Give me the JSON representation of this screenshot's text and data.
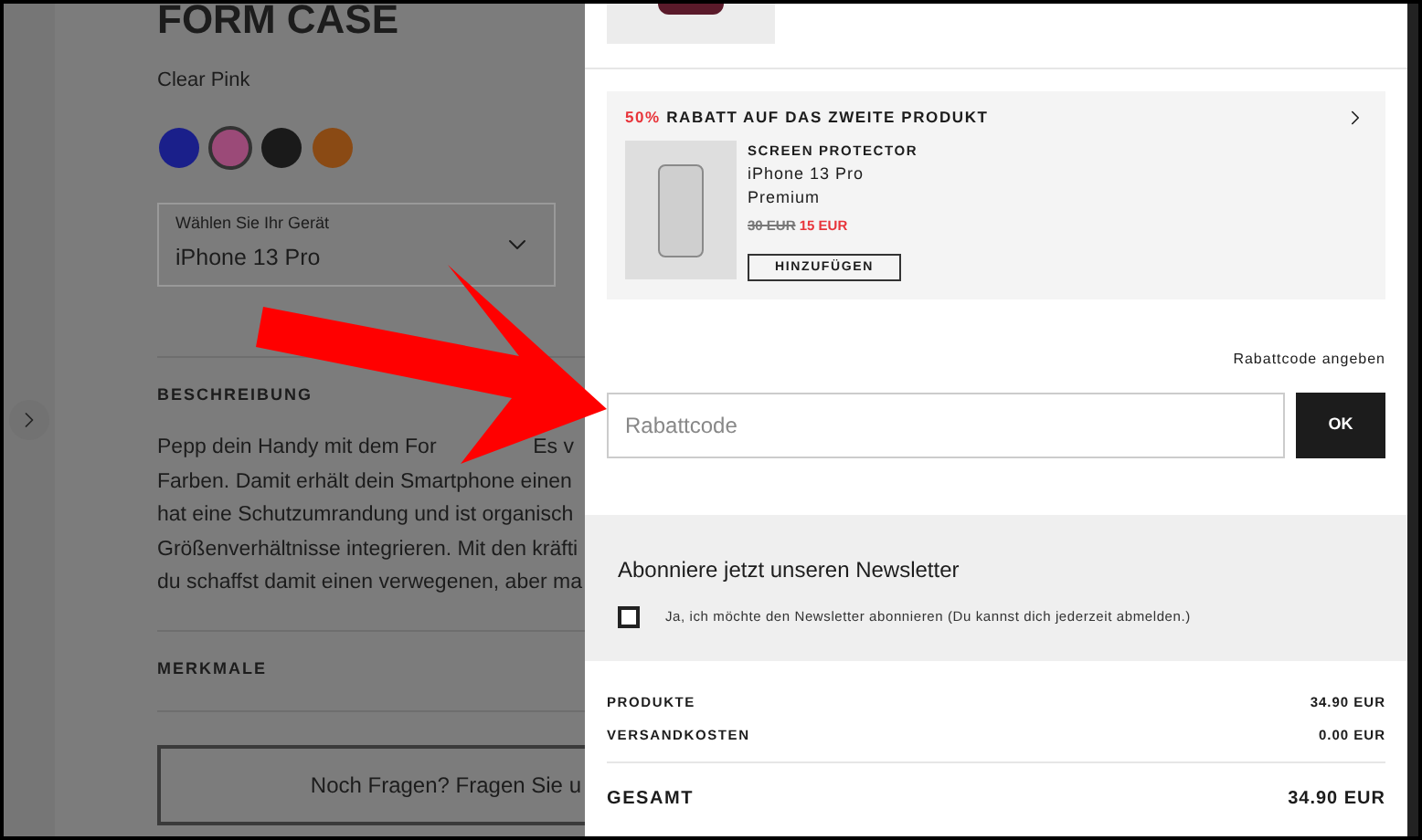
{
  "product_page": {
    "title": "FORM CASE",
    "color_name": "Clear Pink",
    "swatches": [
      {
        "color": "#1a1f8a",
        "selected": false
      },
      {
        "color": "#9b4a78",
        "selected": true
      },
      {
        "color": "#1a1a1a",
        "selected": false
      },
      {
        "color": "#8a4a14",
        "selected": false
      }
    ],
    "device_select": {
      "label": "Wählen Sie Ihr Gerät",
      "value": "iPhone 13 Pro"
    },
    "description": {
      "heading": "BESCHREIBUNG",
      "first_line": {
        "start": "Pepp dein Handy mit dem For",
        "end": "Es v"
      },
      "lines": [
        "Farben. Damit erhält dein Smartphone einen",
        "hat eine Schutzumrandung und ist organisch",
        "Größenverhältnisse integrieren. Mit den kräfti",
        "du schaffst damit einen verwegenen, aber ma"
      ]
    },
    "features": {
      "heading": "MERKMALE"
    },
    "question_button": "Noch Fragen? Fragen Sie u"
  },
  "cart": {
    "promo": {
      "discount": "50%",
      "title": "RABATT AUF DAS ZWEITE PRODUKT",
      "category": "SCREEN PROTECTOR",
      "name_lines": [
        "iPhone 13 Pro",
        "Premium"
      ],
      "old_price": "30 EUR",
      "new_price": "15 EUR",
      "add_button": "HINZUFÜGEN"
    },
    "discount_link": "Rabattcode angeben",
    "discount_input": {
      "placeholder": "Rabattcode"
    },
    "ok_button": "OK",
    "newsletter": {
      "title": "Abonniere jetzt unseren Newsletter",
      "checkbox": {
        "label": "Ja, ich möchte den Newsletter abonnieren (Du kannst dich jederzeit abmelden.)",
        "checked": false
      }
    },
    "summary": [
      {
        "label": "PRODUKTE",
        "value": "34.90 EUR"
      },
      {
        "label": "VERSANDKOSTEN",
        "value": "0.00 EUR"
      }
    ],
    "total": {
      "label": "GESAMT",
      "value": "34.90 EUR"
    }
  }
}
